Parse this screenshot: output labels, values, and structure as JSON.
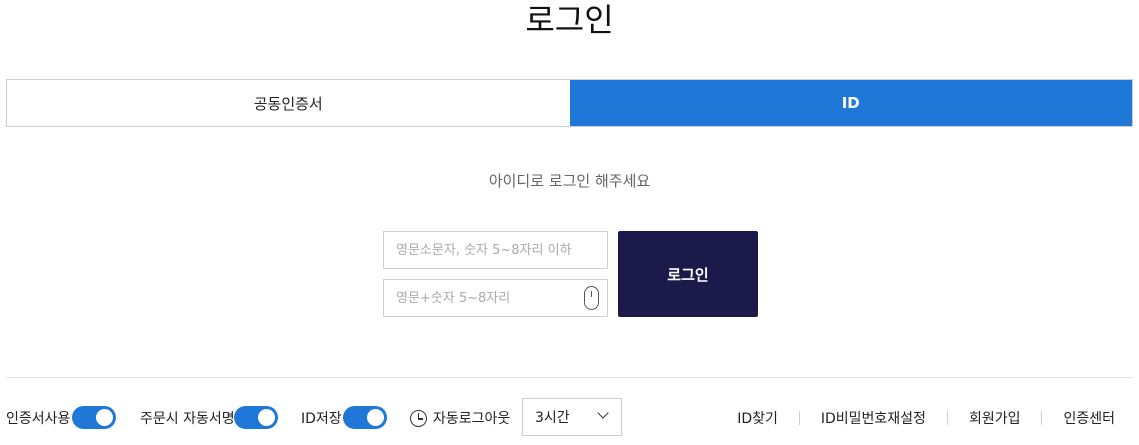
{
  "page": {
    "title": "로그인"
  },
  "tabs": [
    {
      "label": "공동인증서",
      "active": false
    },
    {
      "label": "ID",
      "active": true
    }
  ],
  "subtitle": "아이디로 로그인 해주세요",
  "form": {
    "id_placeholder": "영문소문자, 숫자 5~8자리 이하",
    "id_value": "",
    "pw_placeholder": "영문+숫자 5~8자리",
    "pw_value": "",
    "login_label": "로그인"
  },
  "options": {
    "cert_use": {
      "label": "인증서사용",
      "on": true
    },
    "order_auto_sign": {
      "label": "주문시 자동서명",
      "on": true
    },
    "save_id": {
      "label": "ID저장",
      "on": true
    },
    "auto_logout": {
      "label": "자동로그아웃",
      "selected": "3시간"
    }
  },
  "links": [
    "ID찾기",
    "ID비밀번호재설정",
    "회원가입",
    "인증센터"
  ],
  "colors": {
    "accent": "#1f78d8",
    "login_button": "#1b1a4b"
  }
}
